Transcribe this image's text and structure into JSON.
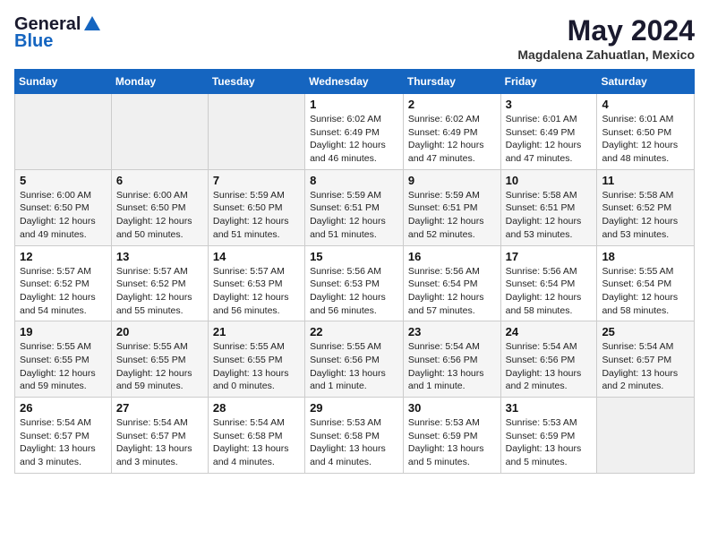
{
  "logo": {
    "general": "General",
    "blue": "Blue"
  },
  "title": "May 2024",
  "location": "Magdalena Zahuatlan, Mexico",
  "weekdays": [
    "Sunday",
    "Monday",
    "Tuesday",
    "Wednesday",
    "Thursday",
    "Friday",
    "Saturday"
  ],
  "weeks": [
    [
      {
        "day": "",
        "info": ""
      },
      {
        "day": "",
        "info": ""
      },
      {
        "day": "",
        "info": ""
      },
      {
        "day": "1",
        "info": "Sunrise: 6:02 AM\nSunset: 6:49 PM\nDaylight: 12 hours\nand 46 minutes."
      },
      {
        "day": "2",
        "info": "Sunrise: 6:02 AM\nSunset: 6:49 PM\nDaylight: 12 hours\nand 47 minutes."
      },
      {
        "day": "3",
        "info": "Sunrise: 6:01 AM\nSunset: 6:49 PM\nDaylight: 12 hours\nand 47 minutes."
      },
      {
        "day": "4",
        "info": "Sunrise: 6:01 AM\nSunset: 6:50 PM\nDaylight: 12 hours\nand 48 minutes."
      }
    ],
    [
      {
        "day": "5",
        "info": "Sunrise: 6:00 AM\nSunset: 6:50 PM\nDaylight: 12 hours\nand 49 minutes."
      },
      {
        "day": "6",
        "info": "Sunrise: 6:00 AM\nSunset: 6:50 PM\nDaylight: 12 hours\nand 50 minutes."
      },
      {
        "day": "7",
        "info": "Sunrise: 5:59 AM\nSunset: 6:50 PM\nDaylight: 12 hours\nand 51 minutes."
      },
      {
        "day": "8",
        "info": "Sunrise: 5:59 AM\nSunset: 6:51 PM\nDaylight: 12 hours\nand 51 minutes."
      },
      {
        "day": "9",
        "info": "Sunrise: 5:59 AM\nSunset: 6:51 PM\nDaylight: 12 hours\nand 52 minutes."
      },
      {
        "day": "10",
        "info": "Sunrise: 5:58 AM\nSunset: 6:51 PM\nDaylight: 12 hours\nand 53 minutes."
      },
      {
        "day": "11",
        "info": "Sunrise: 5:58 AM\nSunset: 6:52 PM\nDaylight: 12 hours\nand 53 minutes."
      }
    ],
    [
      {
        "day": "12",
        "info": "Sunrise: 5:57 AM\nSunset: 6:52 PM\nDaylight: 12 hours\nand 54 minutes."
      },
      {
        "day": "13",
        "info": "Sunrise: 5:57 AM\nSunset: 6:52 PM\nDaylight: 12 hours\nand 55 minutes."
      },
      {
        "day": "14",
        "info": "Sunrise: 5:57 AM\nSunset: 6:53 PM\nDaylight: 12 hours\nand 56 minutes."
      },
      {
        "day": "15",
        "info": "Sunrise: 5:56 AM\nSunset: 6:53 PM\nDaylight: 12 hours\nand 56 minutes."
      },
      {
        "day": "16",
        "info": "Sunrise: 5:56 AM\nSunset: 6:54 PM\nDaylight: 12 hours\nand 57 minutes."
      },
      {
        "day": "17",
        "info": "Sunrise: 5:56 AM\nSunset: 6:54 PM\nDaylight: 12 hours\nand 58 minutes."
      },
      {
        "day": "18",
        "info": "Sunrise: 5:55 AM\nSunset: 6:54 PM\nDaylight: 12 hours\nand 58 minutes."
      }
    ],
    [
      {
        "day": "19",
        "info": "Sunrise: 5:55 AM\nSunset: 6:55 PM\nDaylight: 12 hours\nand 59 minutes."
      },
      {
        "day": "20",
        "info": "Sunrise: 5:55 AM\nSunset: 6:55 PM\nDaylight: 12 hours\nand 59 minutes."
      },
      {
        "day": "21",
        "info": "Sunrise: 5:55 AM\nSunset: 6:55 PM\nDaylight: 13 hours\nand 0 minutes."
      },
      {
        "day": "22",
        "info": "Sunrise: 5:55 AM\nSunset: 6:56 PM\nDaylight: 13 hours\nand 1 minute."
      },
      {
        "day": "23",
        "info": "Sunrise: 5:54 AM\nSunset: 6:56 PM\nDaylight: 13 hours\nand 1 minute."
      },
      {
        "day": "24",
        "info": "Sunrise: 5:54 AM\nSunset: 6:56 PM\nDaylight: 13 hours\nand 2 minutes."
      },
      {
        "day": "25",
        "info": "Sunrise: 5:54 AM\nSunset: 6:57 PM\nDaylight: 13 hours\nand 2 minutes."
      }
    ],
    [
      {
        "day": "26",
        "info": "Sunrise: 5:54 AM\nSunset: 6:57 PM\nDaylight: 13 hours\nand 3 minutes."
      },
      {
        "day": "27",
        "info": "Sunrise: 5:54 AM\nSunset: 6:57 PM\nDaylight: 13 hours\nand 3 minutes."
      },
      {
        "day": "28",
        "info": "Sunrise: 5:54 AM\nSunset: 6:58 PM\nDaylight: 13 hours\nand 4 minutes."
      },
      {
        "day": "29",
        "info": "Sunrise: 5:53 AM\nSunset: 6:58 PM\nDaylight: 13 hours\nand 4 minutes."
      },
      {
        "day": "30",
        "info": "Sunrise: 5:53 AM\nSunset: 6:59 PM\nDaylight: 13 hours\nand 5 minutes."
      },
      {
        "day": "31",
        "info": "Sunrise: 5:53 AM\nSunset: 6:59 PM\nDaylight: 13 hours\nand 5 minutes."
      },
      {
        "day": "",
        "info": ""
      }
    ]
  ]
}
